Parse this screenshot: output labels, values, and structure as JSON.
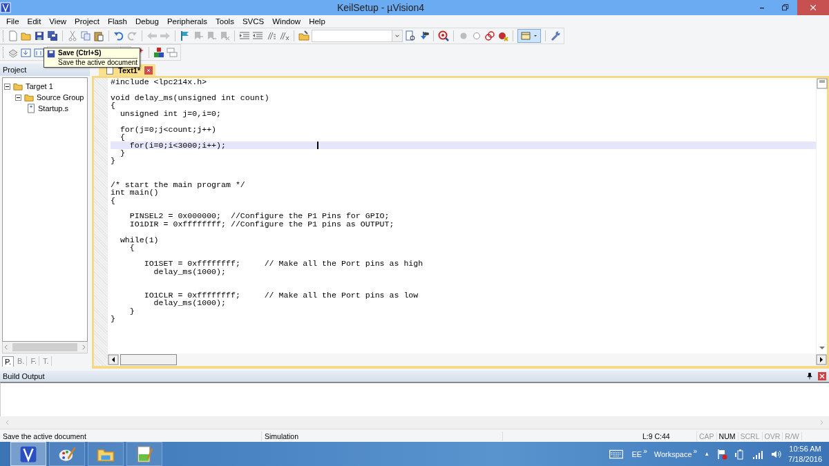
{
  "window": {
    "title": "KeilSetup  - µVision4"
  },
  "menu": [
    "File",
    "Edit",
    "View",
    "Project",
    "Flash",
    "Debug",
    "Peripherals",
    "Tools",
    "SVCS",
    "Window",
    "Help"
  ],
  "tooltip": {
    "title": "Save (Ctrl+S)",
    "description": "Save the active document"
  },
  "project_panel": {
    "title": "Project",
    "tree": [
      {
        "label": "Target 1",
        "expanded": true,
        "children": [
          {
            "label": "Source Group",
            "expanded": true,
            "children": [
              {
                "label": "Startup.s"
              }
            ]
          }
        ]
      }
    ],
    "tabs": [
      {
        "label": "P.",
        "selected": true
      },
      {
        "label": "B.",
        "selected": false
      },
      {
        "label": "F.",
        "selected": false
      },
      {
        "label": "T.",
        "selected": false
      }
    ]
  },
  "editor": {
    "tabs": [
      {
        "label": "Text1*",
        "selected": true
      }
    ],
    "lines": [
      {
        "text": "#include <lpc214x.h>",
        "current": false
      },
      {
        "current": false
      },
      {
        "text": "void delay_ms(unsigned int count)",
        "current": false
      },
      {
        "text": "{",
        "current": false
      },
      {
        "text": "  unsigned int j=0,i=0;",
        "current": false
      },
      {
        "current": false
      },
      {
        "text": "  for(j=0;j<count;j++)",
        "current": false
      },
      {
        "text": "  {",
        "current": false
      },
      {
        "text": "    for(i=0;i<3000;i++);",
        "current": true
      },
      {
        "text": "  }",
        "current": false
      },
      {
        "text": "}",
        "current": false
      },
      {
        "current": false
      },
      {
        "current": false
      },
      {
        "text": "/* start the main program */",
        "current": false
      },
      {
        "text": "int main()",
        "current": false
      },
      {
        "text": "{",
        "current": false
      },
      {
        "current": false
      },
      {
        "text": "    PINSEL2 = 0x000000;  //Configure the P1 Pins for GPIO;",
        "current": false
      },
      {
        "text": "    IO1DIR = 0xffffffff; //Configure the P1 pins as OUTPUT;",
        "current": false
      },
      {
        "current": false
      },
      {
        "text": "  while(1)",
        "current": false
      },
      {
        "text": "    {",
        "current": false
      },
      {
        "current": false
      },
      {
        "text": "       IO1SET = 0xffffffff;     // Make all the Port pins as high",
        "current": false
      },
      {
        "text": "         delay_ms(1000);",
        "current": false
      },
      {
        "current": false
      },
      {
        "current": false
      },
      {
        "text": "       IO1CLR = 0xffffffff;     // Make all the Port pins as low",
        "current": false
      },
      {
        "text": "         delay_ms(1000);",
        "current": false
      },
      {
        "text": "    }",
        "current": false
      },
      {
        "text": "}",
        "current": false
      }
    ]
  },
  "build_output": {
    "title": "Build Output"
  },
  "status_bar": {
    "message": "Save the active document",
    "target": "Simulation",
    "position": "L:9 C:44",
    "indicators": [
      {
        "label": "CAP",
        "on": false
      },
      {
        "label": "NUM",
        "on": true
      },
      {
        "label": "SCRL",
        "on": false
      },
      {
        "label": "OVR",
        "on": false
      },
      {
        "label": "R/W",
        "on": false
      }
    ]
  },
  "taskbar": {
    "apps": [
      {
        "kind": "uvision",
        "selected": true
      },
      {
        "kind": "paint",
        "selected": false
      },
      {
        "kind": "explorer",
        "selected": false
      },
      {
        "kind": "notepad",
        "selected": false
      }
    ],
    "toolbars": [
      {
        "label": "EE",
        "chevron": "»"
      },
      {
        "label": "Workspace",
        "chevron": "»"
      }
    ],
    "tray_arrow": "▲",
    "time": "10:56 AM",
    "date": "7/18/2016"
  }
}
